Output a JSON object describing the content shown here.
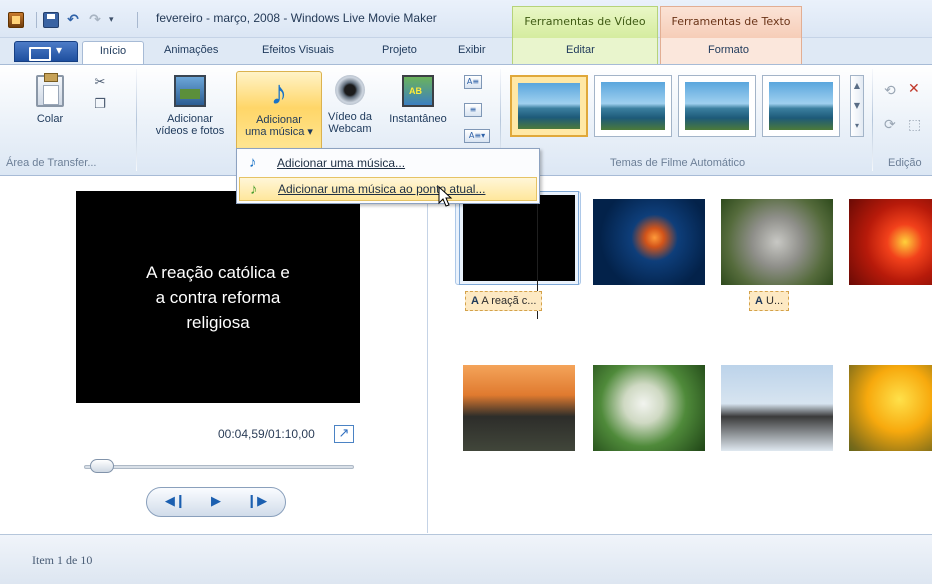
{
  "window": {
    "title": "fevereiro - março, 2008 - Windows Live Movie Maker",
    "qat_dropdown": "▾"
  },
  "context_tabs": {
    "video_tools": "Ferramentas de Vídeo",
    "text_tools": "Ferramentas de Texto"
  },
  "tabs": [
    {
      "label": "Início"
    },
    {
      "label": "Animações"
    },
    {
      "label": "Efeitos Visuais"
    },
    {
      "label": "Projeto"
    },
    {
      "label": "Exibir"
    },
    {
      "label": "Editar"
    },
    {
      "label": "Formato"
    }
  ],
  "ribbon": {
    "clipboard": {
      "paste": "Colar",
      "group": "Área de Transfer..."
    },
    "add": {
      "add_videos_line1": "Adicionar",
      "add_videos_line2": "vídeos e fotos",
      "add_music_line1": "Adicionar",
      "add_music_line2": "uma música ▾",
      "webcam_line1": "Vídeo da",
      "webcam_line2": "Webcam",
      "snapshot": "Instantâneo"
    },
    "themes": {
      "group": "Temas de Filme Automático"
    },
    "editing": {
      "group": "Edição"
    }
  },
  "music_menu": {
    "item1": "Adicionar uma música...",
    "item2": "Adicionar uma música ao ponto atual..."
  },
  "preview": {
    "caption_line1": "A reação católica e",
    "caption_line2": "a contra reforma",
    "caption_line3": "religiosa",
    "timecode": "00:04,59/01:10,00",
    "seek_position_fraction": 0.065
  },
  "storyboard": {
    "caption1": "A reaçã c...",
    "caption2": "U..."
  },
  "status": {
    "text": "Item 1 de 10"
  }
}
